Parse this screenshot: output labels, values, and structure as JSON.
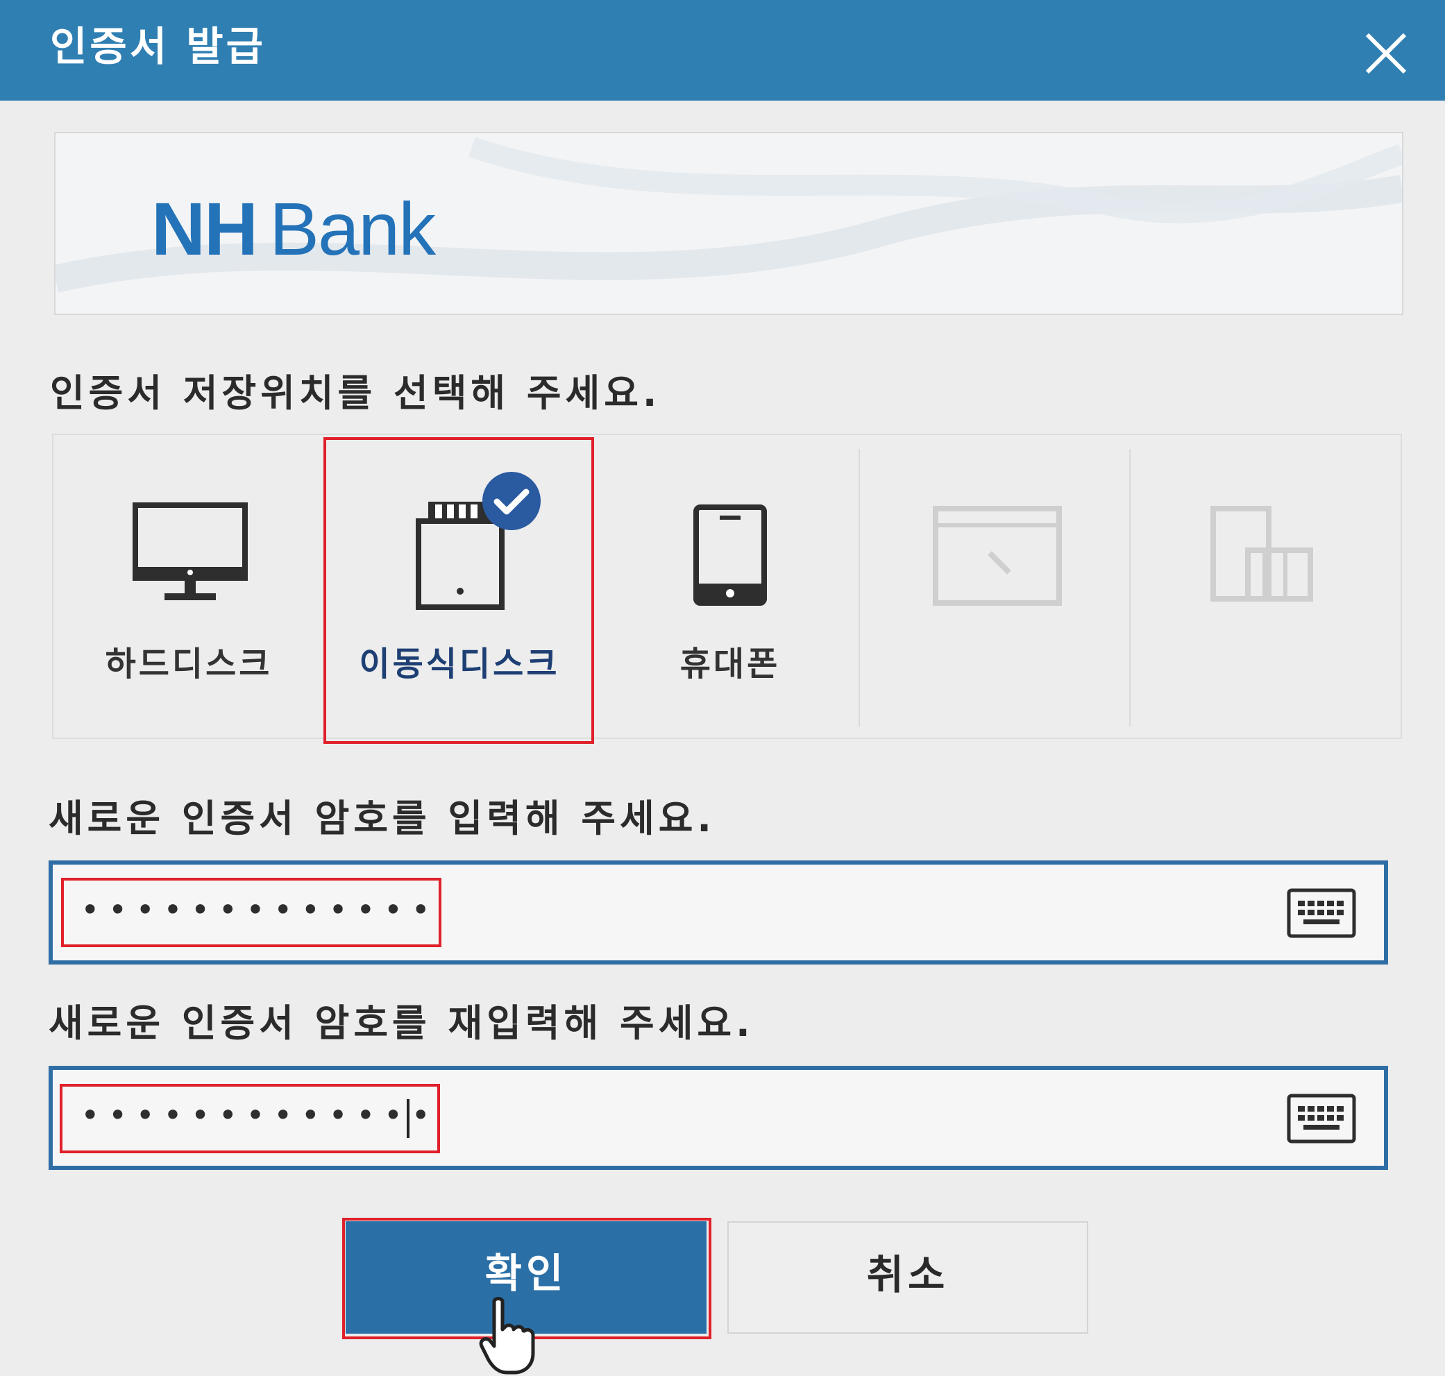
{
  "window": {
    "title": "인증서 발급"
  },
  "banner": {
    "logo_nh": "NH",
    "logo_bank": "Bank"
  },
  "storage": {
    "prompt": "인증서 저장위치를 선택해 주세요.",
    "options": [
      {
        "label": "하드디스크",
        "icon": "monitor-icon",
        "state": "enabled"
      },
      {
        "label": "이동식디스크",
        "icon": "usb-drive-icon",
        "state": "selected"
      },
      {
        "label": "휴대폰",
        "icon": "phone-icon",
        "state": "enabled"
      },
      {
        "label": "",
        "icon": "browser-window-icon",
        "state": "disabled"
      },
      {
        "label": "",
        "icon": "smart-devices-icon",
        "state": "disabled"
      }
    ]
  },
  "password": {
    "prompt": "새로운 인증서 암호를 입력해 주세요.",
    "masked_value": "•••••••••••••"
  },
  "password_confirm": {
    "prompt": "새로운 인증서 암호를 재입력해 주세요.",
    "masked_value": "•••••••••••••"
  },
  "buttons": {
    "ok": "확인",
    "cancel": "취소"
  },
  "colors": {
    "titlebar": "#2f7fb3",
    "accent": "#2a6fa6",
    "highlight": "#e0202a",
    "selected_check": "#2a5aa0"
  }
}
